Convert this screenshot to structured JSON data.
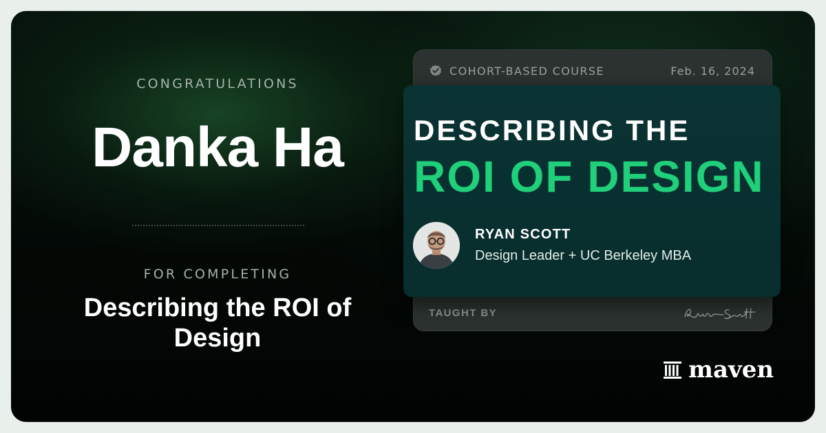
{
  "certificate": {
    "eyebrow_top": "CONGRATULATIONS",
    "recipient_name": "Danka Ha",
    "eyebrow_bottom": "FOR COMPLETING",
    "course_title": "Describing the ROI of Design"
  },
  "card": {
    "course_type": "COHORT-BASED COURSE",
    "date": "Feb. 16, 2024",
    "title_line1": "DESCRIBING THE",
    "title_line2": "ROI OF DESIGN",
    "instructor_name": "RYAN SCOTT",
    "instructor_role": "Design Leader + UC Berkeley MBA",
    "taught_by_label": "TAUGHT BY",
    "signature_icon": "signature"
  },
  "brand": {
    "name": "maven",
    "icon": "maven-columns-icon"
  },
  "colors": {
    "accent_green": "#1fcf7a",
    "card_teal": "#082d2d",
    "background_dark": "#030805"
  }
}
